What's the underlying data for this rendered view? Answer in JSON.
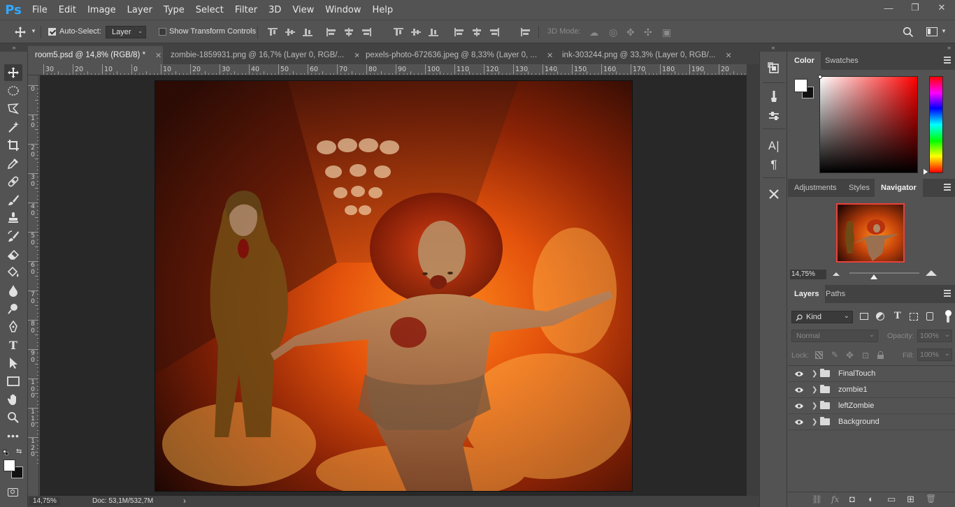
{
  "app": {
    "logo": "Ps"
  },
  "menu": [
    "File",
    "Edit",
    "Image",
    "Layer",
    "Type",
    "Select",
    "Filter",
    "3D",
    "View",
    "Window",
    "Help"
  ],
  "window_controls": {
    "minimize": "—",
    "restore": "❐",
    "close": "✕"
  },
  "options": {
    "auto_select_label": "Auto-Select:",
    "auto_select_checked": true,
    "auto_select_value": "Layer",
    "transform_controls_label": "Show Transform Controls",
    "transform_controls_checked": false,
    "mode_3d_label": "3D Mode:"
  },
  "tabs": [
    {
      "label": "room5.psd @ 14,8% (RGB/8) *",
      "active": true
    },
    {
      "label": "zombie-1859931.png @ 16,7% (Layer 0, RGB/...",
      "active": false
    },
    {
      "label": "pexels-photo-672636.jpeg @ 8,33% (Layer 0, ...",
      "active": false
    },
    {
      "label": "ink-303244.png @ 33,3% (Layer 0, RGB/...",
      "active": false
    }
  ],
  "ruler_h_labels": [
    "30",
    "20",
    "10",
    "0",
    "10",
    "20",
    "30",
    "40",
    "50",
    "60",
    "70",
    "80",
    "90",
    "100",
    "110",
    "120",
    "130",
    "140",
    "150",
    "160",
    "170",
    "180",
    "190",
    "20"
  ],
  "ruler_v_labels": [
    "0",
    "1\n0",
    "2\n0",
    "3\n0",
    "4\n0",
    "5\n0",
    "6\n0",
    "7\n0",
    "8\n0",
    "9\n0",
    "1\n0\n0",
    "1\n1\n0",
    "1\n2\n0"
  ],
  "status": {
    "zoom": "14,75%",
    "doc": "Doc: 53,1M/532,7M",
    "arrow": "›"
  },
  "color_panel": {
    "tabs": [
      "Color",
      "Swatches"
    ],
    "active_tab": "Color",
    "hue_color": "#ff0000"
  },
  "navigator_panel": {
    "tabs": [
      "Adjustments",
      "Styles",
      "Navigator"
    ],
    "active_tab": "Navigator",
    "zoom": "14,75%"
  },
  "layers_panel": {
    "tabs": [
      "Layers",
      "Paths"
    ],
    "active_tab": "Layers",
    "filter_kind": "Kind",
    "blend_mode": "Normal",
    "opacity_label": "Opacity:",
    "opacity_value": "100%",
    "lock_label": "Lock:",
    "fill_label": "Fill:",
    "fill_value": "100%",
    "layers": [
      {
        "name": "FinalTouch",
        "type": "group",
        "visible": true
      },
      {
        "name": "zombie1",
        "type": "group",
        "visible": true
      },
      {
        "name": "leftZombie",
        "type": "group",
        "visible": true
      },
      {
        "name": "Background",
        "type": "group",
        "visible": true
      }
    ],
    "footer_icons": [
      "link-icon",
      "fx-icon",
      "mask-icon",
      "adjustment-icon",
      "group-icon",
      "new-layer-icon",
      "trash-icon"
    ],
    "footer_glyphs": [
      "⛓",
      "fx",
      "◘",
      "◐",
      "▭",
      "⊞",
      "🗑"
    ]
  },
  "colors": {
    "accent": "#31a8ff",
    "panel_bg": "#535353",
    "dark_bg": "#282828"
  }
}
